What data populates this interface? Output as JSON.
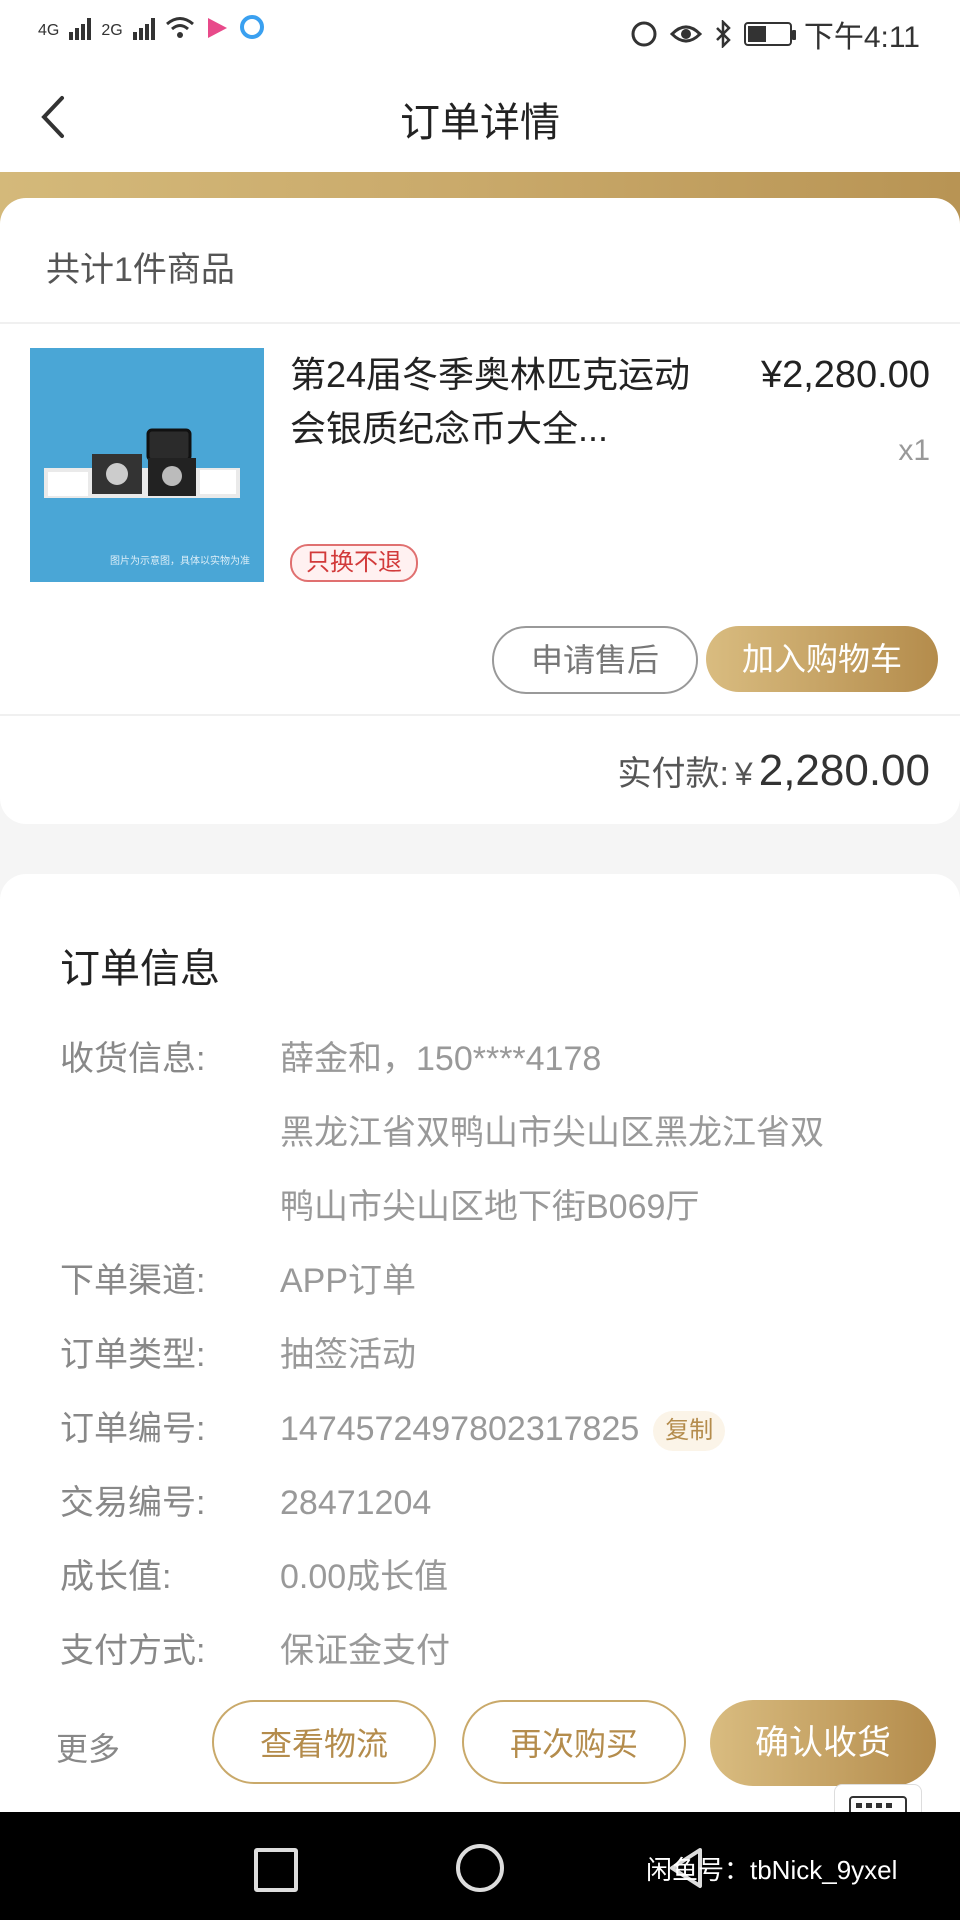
{
  "status_bar": {
    "net1": "4G",
    "net2": "2G",
    "time": "下午4:11",
    "battery_level": 0.45
  },
  "header": {
    "back_icon": "chevron-left-icon",
    "title": "订单详情"
  },
  "product_card": {
    "count_text": "共计1件商品",
    "product_name": "第24届冬季奥林匹克运动会银质纪念币大全...",
    "price": "¥2,280.00",
    "quantity": "x1",
    "tag": "只换不退",
    "thumb_caption": "图片为示意图，具体以实物为准",
    "after_sale_label": "申请售后",
    "add_cart_label": "加入购物车",
    "paid_label": "实付款:",
    "paid_currency": "¥",
    "paid_amount": "2,280.00"
  },
  "order_info": {
    "title": "订单信息",
    "rows": [
      {
        "label": "收货信息:",
        "value": "薛金和，150****4178"
      },
      {
        "label": "",
        "value": "黑龙江省双鸭山市尖山区黑龙江省双"
      },
      {
        "label": "",
        "value": "鸭山市尖山区地下街B069厅"
      },
      {
        "label": "下单渠道:",
        "value": "APP订单"
      },
      {
        "label": "订单类型:",
        "value": "抽签活动"
      },
      {
        "label": "订单编号:",
        "value": "1474572497802317825"
      },
      {
        "label": "交易编号:",
        "value": "28471204"
      },
      {
        "label": "成长值:",
        "value": "0.00成长值"
      },
      {
        "label": "支付方式:",
        "value": "保证金支付"
      }
    ],
    "copy_label": "复制"
  },
  "action_bar": {
    "more_label": "更多",
    "logistics_label": "查看物流",
    "rebuy_label": "再次购买",
    "confirm_label": "确认收货",
    "keyboard_label": "键盘"
  },
  "nav_bar": {
    "watermark": "闲鱼号：tbNick_9yxel"
  },
  "colors": {
    "gold_light": "#d9bc80",
    "gold_dark": "#b48c4c",
    "tag_red": "#d23a3a"
  }
}
